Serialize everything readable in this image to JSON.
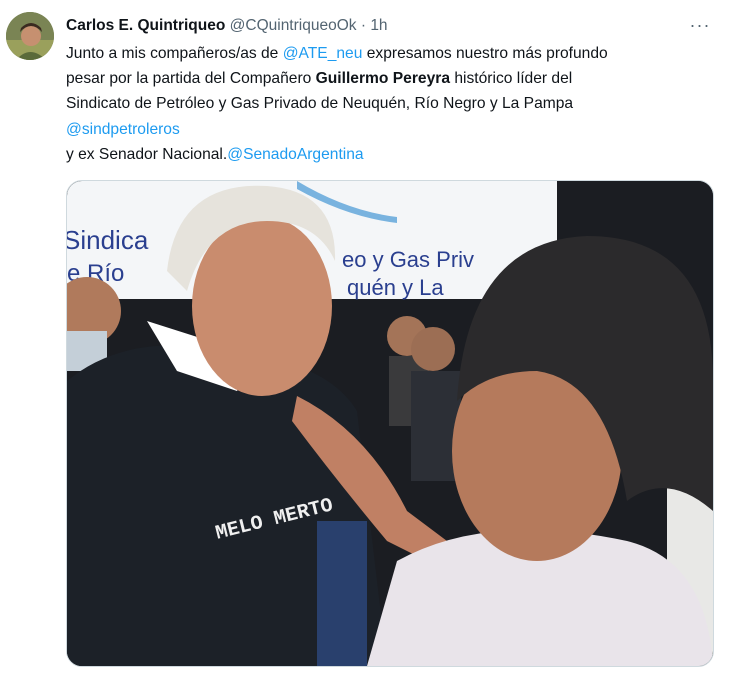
{
  "tweet": {
    "author_name": "Carlos E. Quintriqueo",
    "author_handle": "@CQuintriqueoOk",
    "separator": "·",
    "time": "1h",
    "more_label": "···",
    "text": {
      "l1_a": "Junto a mis compañeros/as de ",
      "l1_mention": "@ATE_neu",
      "l1_b": " expresamos nuestro más profundo",
      "l2_a": "pesar por la partida del Compañero ",
      "l2_bold": "Guillermo Pereyra",
      "l2_b": " histórico líder del",
      "l3": "Sindicato de Petróleo y Gas Privado de Neuquén, Río Negro y La Pampa",
      "l4_mention": "@sindpetroleros",
      "l5_a": "y ex Senador Nacional.",
      "l5_mention": "@SenadoArgentina"
    }
  },
  "photo": {
    "banner_line1": "Sindica",
    "banner_line1b": "eo y Gas Priv",
    "banner_line2": "e Río",
    "banner_line2b": "quén y La",
    "shirt_text": "MELO MERTO",
    "colors": {
      "banner_bg": "#f4f6f8",
      "banner_text": "#2a3f8f",
      "shirt": "#1c2128",
      "skin": "#c98c6e",
      "hair_white": "#e6e3dc",
      "hair_dark": "#2b2a2c",
      "shirt_light": "#e9e4ea"
    }
  }
}
